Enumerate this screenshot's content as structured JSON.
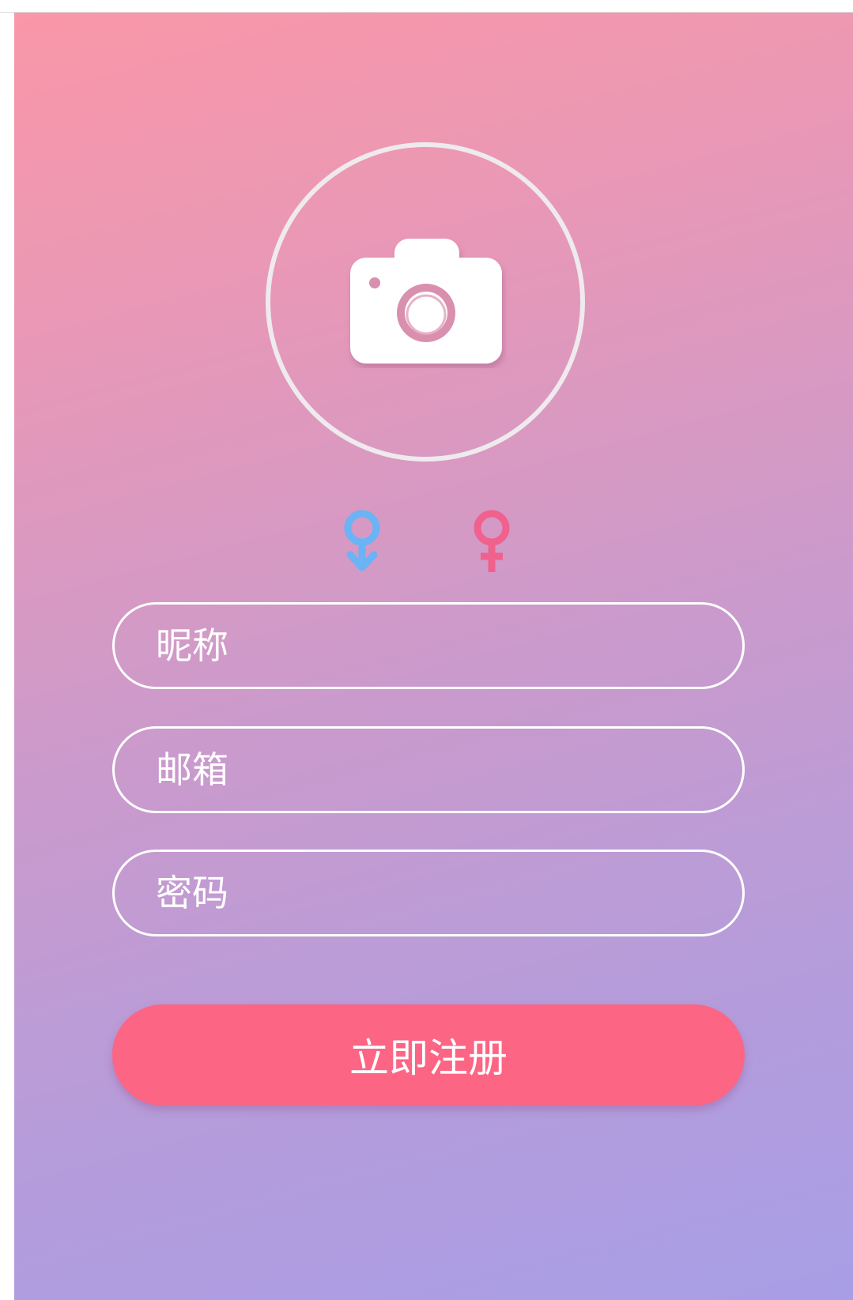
{
  "colors": {
    "gradient_top": "#fa97a8",
    "gradient_bottom": "#a89ee6",
    "avatar_ring": "#eeeaee",
    "male_icon": "#6ab3f5",
    "female_icon": "#f0618e",
    "submit_button": "#fc6584",
    "text": "#ffffff"
  },
  "avatar": {
    "icon": "camera-icon"
  },
  "gender": {
    "options": [
      {
        "icon": "male-symbol-icon"
      },
      {
        "icon": "female-symbol-icon"
      }
    ]
  },
  "form": {
    "nickname": {
      "placeholder": "昵称",
      "value": ""
    },
    "email": {
      "placeholder": "邮箱",
      "value": ""
    },
    "password": {
      "placeholder": "密码",
      "value": ""
    }
  },
  "submit": {
    "label": "立即注册"
  }
}
